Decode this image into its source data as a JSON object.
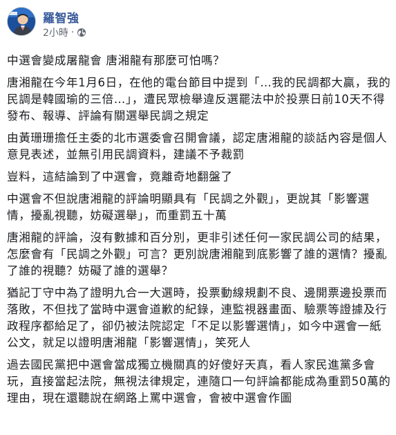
{
  "author": {
    "name": "羅智強",
    "time": "2小時",
    "separator": "·",
    "visibility_icon": "globe-icon"
  },
  "post": {
    "paragraphs": [
      "中選會變成屠龍會 唐湘龍有那麼可怕嗎？",
      "唐湘龍在今年1月6日，在他的電台節目中提到「…我的民調都大贏，我的民調是韓國瑜的三倍…」，遭民眾檢舉違反選罷法中於投票日前10天不得發布、報導、評論有關選舉民調之規定",
      "由黃珊珊擔任主委的北市選委會召開會議，認定唐湘龍的談話內容是個人意見表述，並無引用民調資料，建議不予裁罰",
      "豈料，這結論到了中選會，竟離奇地翻盤了",
      "中選會不但說唐湘龍的評論明顯具有「民調之外觀」，更說其「影響選情，擾亂視聽，妨礙選舉」，而重罰五十萬",
      "唐湘龍的評論，沒有數據和百分別，更非引述任何一家民調公司的結果，怎麼會有「民調之外觀」可言？更別說唐湘龍到底影響了誰的選情？擾亂了誰的視聽？妨礙了誰的選舉？",
      "猶記丁守中為了證明九合一大選時，投票動線規劃不良、邊開票邊投票而落敗，不但找了當時中選會道歉的紀錄，連監視器畫面、驗票等證據及行政程序都給足了，卻仍被法院認定「不足以影響選情」，如今中選會一紙公文，就足以證明唐湘龍「影響選情」，笑死人",
      "過去國民黨把中選會當成獨立機關真的好傻好天真，看人家民進黨多會玩，直接當起法院，無視法律規定，連隨口一句評論都能成為重罰50萬的理由，現在還聽說在網路上罵中選會，會被中選會作圖"
    ]
  },
  "colors": {
    "author_link": "#365899",
    "meta_text": "#616770",
    "body_text": "#1c1e21",
    "avatar_bg": "#1c4f9c"
  }
}
